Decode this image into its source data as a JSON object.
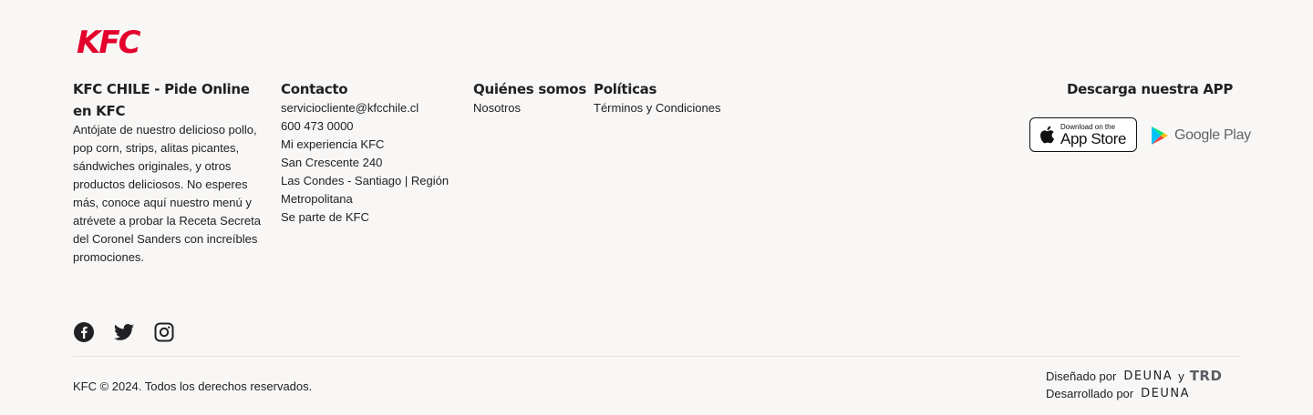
{
  "logo": {
    "text": "KFC"
  },
  "about": {
    "title": "KFC CHILE - Pide Online en KFC",
    "text": "Antójate de nuestro delicioso pollo, pop corn, strips, alitas picantes, sándwiches originales, y otros productos deliciosos. No esperes más, conoce aquí nuestro menú y atrévete a probar la Receta Secreta del Coronel Sanders con increíbles promociones."
  },
  "contact": {
    "title": "Contacto",
    "items": [
      "serviciocliente@kfcchile.cl",
      "600 473 0000",
      "Mi experiencia KFC",
      "San Crescente 240",
      "Las Condes - Santiago | Región Metropolitana",
      "Se parte de KFC"
    ]
  },
  "quienes": {
    "title": "Quiénes somos",
    "items": [
      "Nosotros"
    ]
  },
  "politicas": {
    "title": "Políticas",
    "items": [
      "Términos y Condiciones"
    ]
  },
  "app": {
    "title": "Descarga nuestra APP",
    "appstore_small": "Download on the",
    "appstore_big": "App Store",
    "googleplay": "Google Play"
  },
  "social": [
    "facebook-icon",
    "twitter-icon",
    "instagram-icon"
  ],
  "footer": {
    "copyright": "KFC © 2024. Todos los derechos reservados.",
    "designed_label": "Diseñado por",
    "designed_brand": "DEUNA",
    "conj": "y",
    "designed_brand2": "TRD",
    "developed_label": "Desarrollado por",
    "developed_brand": "DEUNA"
  },
  "colors": {
    "brand": "#e4002b",
    "background": "#f8f7f5"
  }
}
